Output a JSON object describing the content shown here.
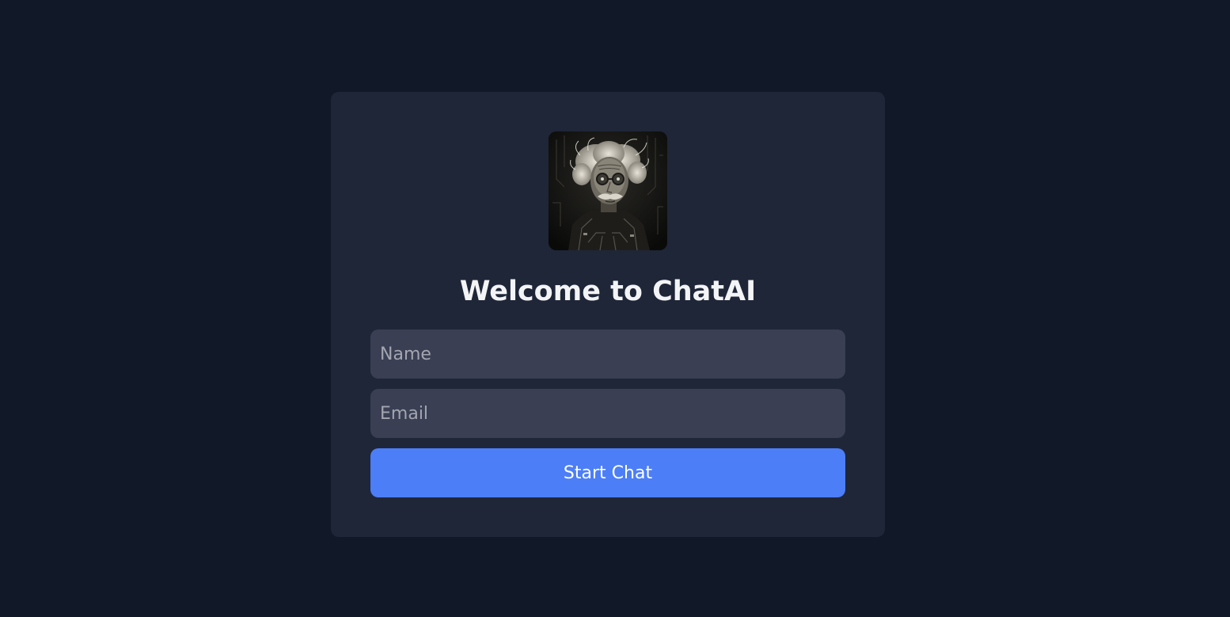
{
  "welcome": {
    "title": "Welcome to ChatAI",
    "avatar_icon": "scientist-portrait-avatar"
  },
  "form": {
    "name_placeholder": "Name",
    "name_value": "",
    "email_placeholder": "Email",
    "email_value": "",
    "submit_label": "Start Chat"
  },
  "colors": {
    "page_background": "#111827",
    "card_background": "#1f2638",
    "input_background": "#3a3f53",
    "accent": "#4c7ef7",
    "title_text": "#f3f4f6",
    "placeholder_text": "#a3a6b0"
  }
}
